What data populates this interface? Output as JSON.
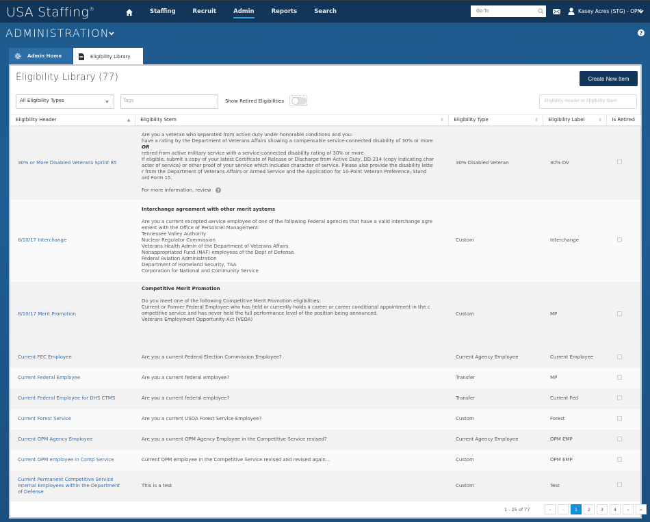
{
  "topbar": {
    "logo": "USA Staffing",
    "logo_mark": "®",
    "nav": [
      "Staffing",
      "Recruit",
      "Admin",
      "Reports",
      "Search"
    ],
    "active_nav": "Admin",
    "goto_placeholder": "Go To",
    "user_name": "Kasey Acres (STG) - OPM"
  },
  "section": {
    "title": "ADMINISTRATION"
  },
  "tabs": [
    {
      "label": "Admin Home",
      "icon": "gear-icon"
    },
    {
      "label": "Eligibility Library",
      "icon": "document-icon",
      "active": true
    }
  ],
  "page": {
    "title": "Eligibility Library (77)",
    "create_button": "Create New Item",
    "type_select": "All Eligibility Types",
    "tags_placeholder": "Tags",
    "show_retired_label": "Show Retired Eligibilities",
    "show_retired": false,
    "filter_placeholder": "Eligibility Header or Eligibility Stem"
  },
  "table": {
    "columns": [
      "Eligibility Header",
      "Eligibility Stem",
      "Eligibility Type",
      "Eligibility Label",
      "Is Retired"
    ],
    "rows": [
      {
        "header": "30% or More Disabled Veterans Sprint 85",
        "stem_lines": [
          "Are you a veteran who separated from active duty under honorable conditions and you:",
          "have a rating by the Department of Veterans Affairs showing a compensable service-connected disability of 30% or more",
          "OR",
          "retired from active military service with a service-connected disability rating of 30% or more",
          "If eligible, submit a copy of your latest Certificate of Release or Discharge from Active Duty, DD-214 (copy indicating char",
          "acter of service) or other proof of your service which includes character of service. Please also provide the disability lette",
          "r from the Department of Veterans Affairs or Armed Service and the Application for 10-Point Veteran Preference, Stand",
          "ard Form 15.",
          "",
          "For more information, review"
        ],
        "type": "30% Disabled Veteran",
        "label": "30% DV",
        "retired": false
      },
      {
        "header": "8/10/17 Interchange",
        "stem_title": "Interchange agreement with other merit systems",
        "stem_lines": [
          "Are you a current excepted service employee of one of the following Federal agencies that have a valid interchange agre",
          "ement with the Office of Personnel Management:",
          "Tennessee Valley Authority",
          "Nuclear Regulator Commission",
          "Veterans Health Admin of the Department of Veterans Affairs",
          "Nonappropriated Fund (NAF) employees of the Dept of Defense",
          "Federal Aviation Administration",
          "Department of Homeland Security, TSA",
          "Corporation for National and Community Service"
        ],
        "type": "Custom",
        "label": "Interchange",
        "retired": false
      },
      {
        "header": "8/10/17 Merit Promotion",
        "stem_title": "Competitive Merit Promotion",
        "stem_lines": [
          "Do you meet one of the following Competitive Merit Promotion eligibilities:",
          "Current or Former Federal Employee who has held or currently holds a career or career conditional appointment in the c",
          "ompetitive service and has never held the full performance level of the position being announced.",
          "Veterans Employment Opportunity Act (VEOA)"
        ],
        "type": "Custom",
        "label": "MP",
        "retired": false
      },
      {
        "header": "Current FEC Employee",
        "stem": "Are you a current Federal Election Commission Employee?",
        "type": "Current Agency Employee",
        "label": "Current Employee",
        "retired": false
      },
      {
        "header": "Current Federal Employee",
        "stem": "Are you a current federal employee?",
        "type": "Transfer",
        "label": "MP",
        "retired": false
      },
      {
        "header": "Current Federal Employee for DHS CTMS",
        "stem": "Are you a current federal employee?",
        "type": "Transfer",
        "label": "Current Fed",
        "retired": false
      },
      {
        "header": "Current Forest Service",
        "stem": "Are you a current USDA Forest Service Employee?",
        "type": "Custom",
        "label": "Forest",
        "retired": false
      },
      {
        "header": "Current OPM Agency Employee",
        "stem": "Are you a current OPM Agency Employee in the Competitive Service revised?",
        "type": "Current Agency Employee",
        "label": "OPM EMP",
        "retired": false
      },
      {
        "header": "Current OPM employee in Comp Service",
        "stem": "Current OPM employee in the Competitive Service revised and revised again...",
        "type": "Custom",
        "label": "OPM EMP",
        "retired": false
      },
      {
        "header_lines": [
          "Current Permanent Competitive Service",
          "Internal Employees within the Department",
          "of Defense"
        ],
        "stem": "This is a test",
        "type": "Custom",
        "label": "Test",
        "retired": false
      }
    ]
  },
  "pagination": {
    "info": "1 - 25 of 77",
    "first": "«",
    "prev": "‹",
    "pages": [
      "1",
      "2",
      "3",
      "4"
    ],
    "current": "1",
    "next": "›",
    "last": "»"
  }
}
